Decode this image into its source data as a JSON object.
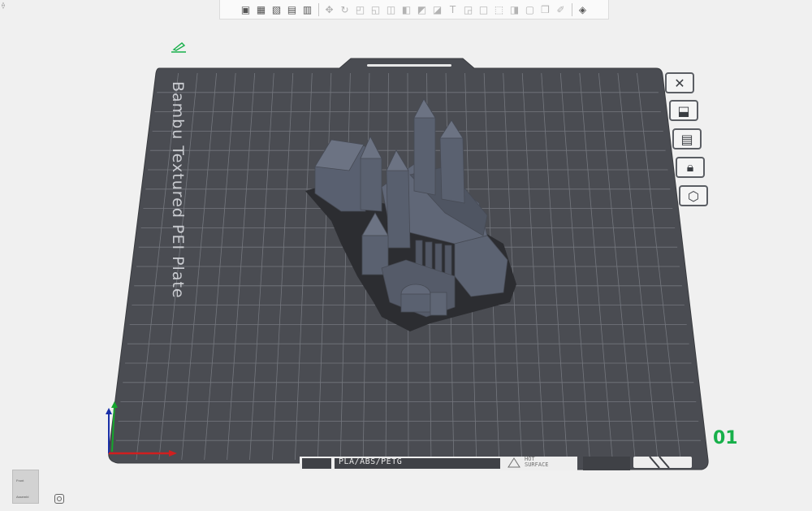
{
  "toolbar": {
    "groups": [
      [
        "add-icon",
        "grid-icon",
        "arrange-icon",
        "plate-icon",
        "list-icon"
      ],
      [
        "move-icon",
        "rotate-icon",
        "scale-icon",
        "lay-on-face-icon",
        "cut-icon",
        "mesh-boolean-icon",
        "support-paint-icon",
        "seam-paint-icon",
        "text-icon",
        "measure-icon",
        "assembly-icon",
        "split-icon",
        "variable-layer-icon",
        "fuzzy-skin-icon",
        "brim-ears-icon",
        "paint-icon"
      ],
      [
        "explode-icon"
      ]
    ]
  },
  "plate": {
    "name": "Bambu Textured PEI Plate",
    "number": "01",
    "material_label": "PLA/ABS/PETG",
    "hot_line1": "HOT",
    "hot_line2": "SURFACE"
  },
  "side_buttons": [
    "close-icon",
    "auto-orient-icon",
    "arrange-icon",
    "lock-icon",
    "settings-icon"
  ],
  "nav_cube": {
    "top_face": "Front",
    "bottom_face": "Assembl"
  },
  "colors": {
    "plate": "#4a4c52",
    "grid": "#74777e",
    "model": "#5d6370",
    "axis_x": "#d01f1f",
    "axis_y": "#15a62c",
    "axis_z": "#1a2fa8",
    "accent": "#17b04a"
  }
}
